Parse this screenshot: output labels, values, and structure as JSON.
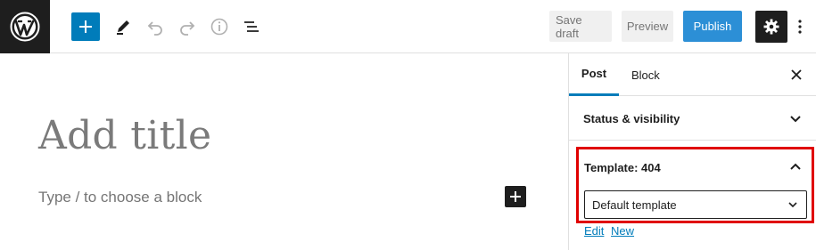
{
  "toolbar": {
    "save_draft_label": "Save draft",
    "preview_label": "Preview",
    "publish_label": "Publish"
  },
  "editor": {
    "title_placeholder": "Add title",
    "block_placeholder": "Type / to choose a block"
  },
  "sidebar": {
    "tabs": [
      {
        "label": "Post"
      },
      {
        "label": "Block"
      }
    ],
    "status_panel_title": "Status & visibility",
    "template_panel_title": "Template: 404",
    "template_select_value": "Default template",
    "links": [
      {
        "label": "Edit"
      },
      {
        "label": "New"
      }
    ]
  },
  "colors": {
    "accent": "#007cba",
    "highlight_border": "#e00000",
    "dark": "#1e1e1e"
  },
  "icons": [
    "wordpress-logo-icon",
    "plus-icon",
    "pencil-icon",
    "undo-icon",
    "redo-icon",
    "info-icon",
    "list-view-icon",
    "gear-icon",
    "more-vertical-icon",
    "close-icon",
    "chevron-down-icon",
    "chevron-up-icon"
  ]
}
